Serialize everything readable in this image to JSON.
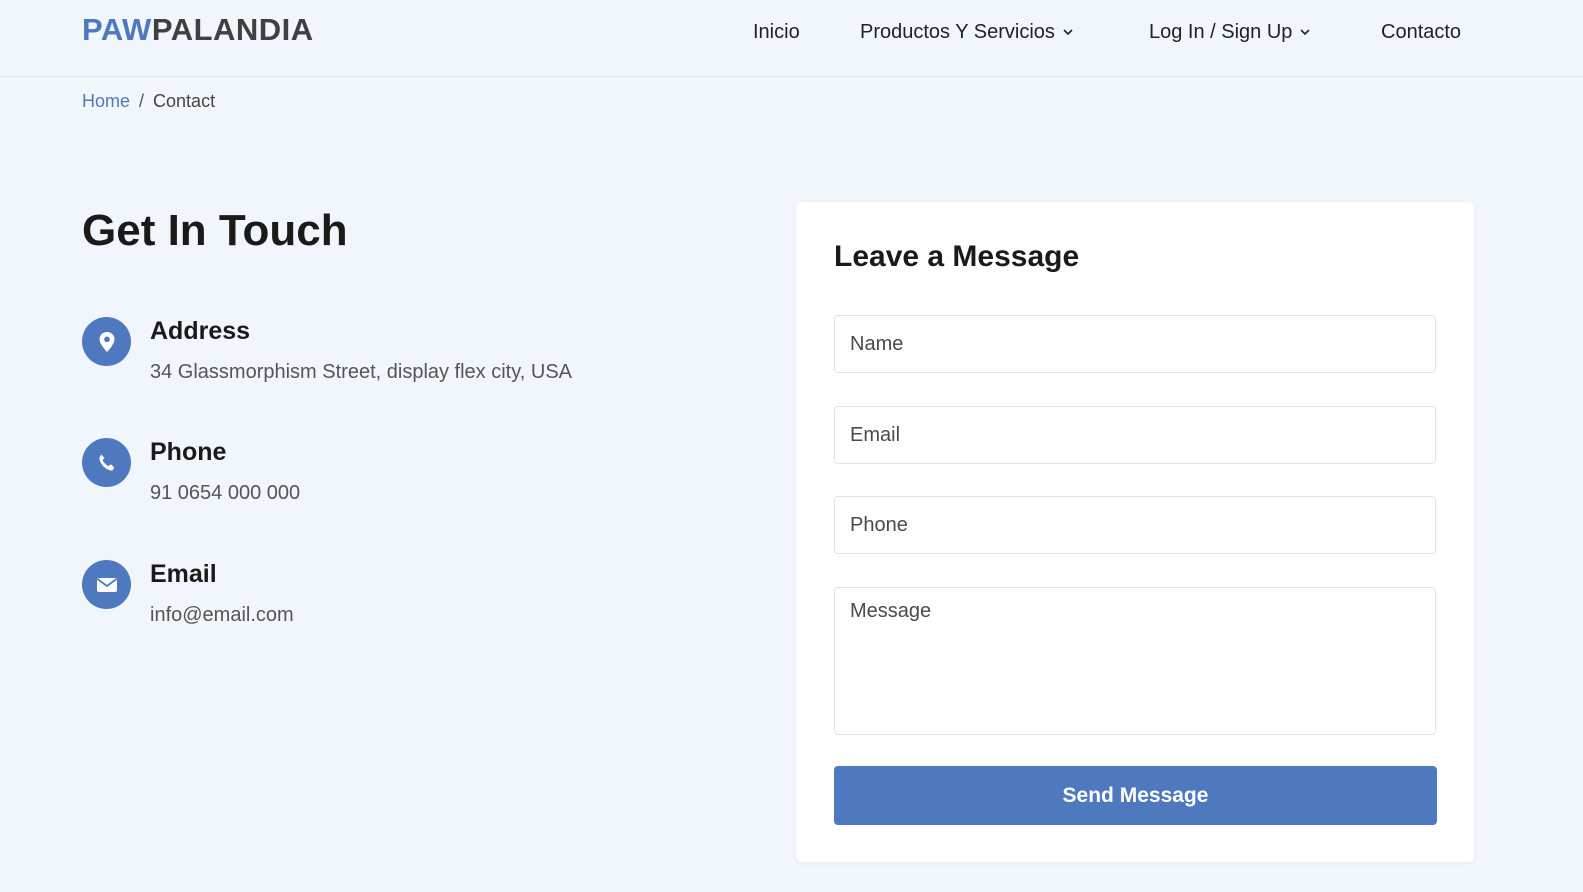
{
  "brand": {
    "part1": "PAW",
    "part2": "PALANDIA",
    "accent_color": "#4e79bf"
  },
  "nav": {
    "inicio": "Inicio",
    "productos": "Productos Y Servicios",
    "login": "Log In / Sign Up",
    "contacto": "Contacto"
  },
  "breadcrumb": {
    "home": "Home",
    "separator": "/",
    "current": "Contact"
  },
  "contact": {
    "heading": "Get In Touch",
    "items": [
      {
        "icon": "map-pin-icon",
        "title": "Address",
        "text": "34 Glassmorphism Street, display flex city, USA"
      },
      {
        "icon": "phone-icon",
        "title": "Phone",
        "text": "91 0654 000 000"
      },
      {
        "icon": "envelope-icon",
        "title": "Email",
        "text": "info@email.com"
      }
    ]
  },
  "form": {
    "title": "Leave a Message",
    "name_placeholder": "Name",
    "email_placeholder": "Email",
    "phone_placeholder": "Phone",
    "message_placeholder": "Message",
    "submit_label": "Send Message"
  }
}
